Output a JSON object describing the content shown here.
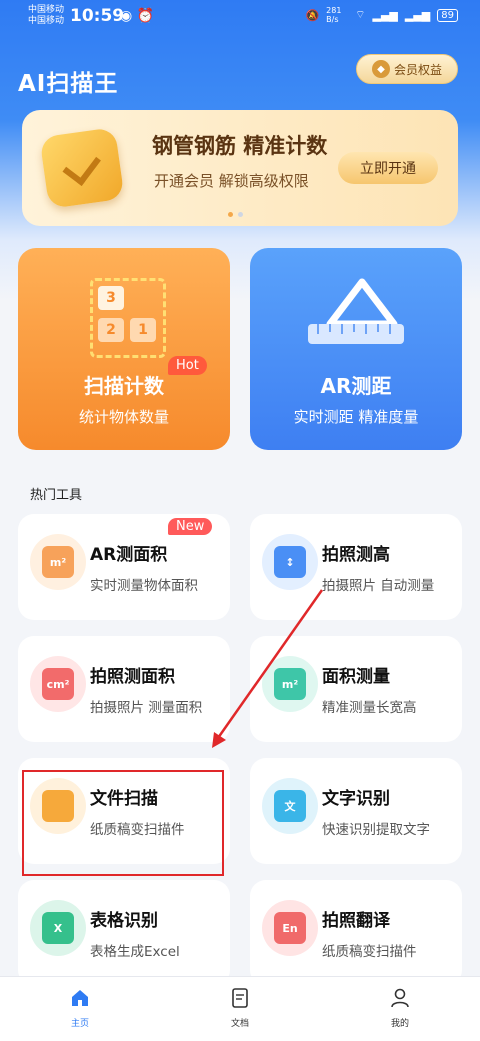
{
  "status": {
    "carrier1": "中国移动",
    "carrier2": "中国移动",
    "time": "10:59",
    "speed": "281 B/s",
    "battery": "89"
  },
  "header": {
    "title": "AI扫描王",
    "vip_label": "会员权益"
  },
  "banner": {
    "title": "钢管钢筋 精准计数",
    "subtitle": "开通会员 解锁高级权限",
    "button": "立即开通"
  },
  "big_cards": [
    {
      "title": "扫描计数",
      "subtitle": "统计物体数量",
      "badge": "Hot",
      "nums": [
        "3",
        "2",
        "1"
      ]
    },
    {
      "title": "AR测距",
      "subtitle": "实时测距 精准度量"
    }
  ],
  "section_title": "热门工具",
  "tools": [
    {
      "title": "AR测面积",
      "subtitle": "实时测量物体面积",
      "badge": "New",
      "icon_text": "m²",
      "color": "#f7a25a",
      "bg": "#fff0e0"
    },
    {
      "title": "拍照测高",
      "subtitle": "拍摄照片 自动测量",
      "icon_text": "↕",
      "color": "#4a8ff5",
      "bg": "#e3efff"
    },
    {
      "title": "拍照测面积",
      "subtitle": "拍摄照片 测量面积",
      "icon_text": "cm²",
      "color": "#f26b6b",
      "bg": "#ffe6e6"
    },
    {
      "title": "面积测量",
      "subtitle": "精准测量长宽高",
      "icon_text": "m²",
      "color": "#3ec6a8",
      "bg": "#dff7f0"
    },
    {
      "title": "文件扫描",
      "subtitle": "纸质稿变扫描件",
      "icon_text": "",
      "color": "#f6a93b",
      "bg": "#fff1dc"
    },
    {
      "title": "文字识别",
      "subtitle": "快速识别提取文字",
      "icon_text": "文",
      "color": "#3ab5e8",
      "bg": "#dff3fb"
    },
    {
      "title": "表格识别",
      "subtitle": "表格生成Excel",
      "icon_text": "X",
      "color": "#35c08c",
      "bg": "#dcf5ea"
    },
    {
      "title": "拍照翻译",
      "subtitle": "纸质稿变扫描件",
      "icon_text": "En",
      "color": "#f06a6a",
      "bg": "#ffe4e4"
    }
  ],
  "tabs": [
    {
      "label": "主页",
      "icon": "home-icon"
    },
    {
      "label": "文档",
      "icon": "document-icon"
    },
    {
      "label": "我的",
      "icon": "profile-icon"
    }
  ]
}
